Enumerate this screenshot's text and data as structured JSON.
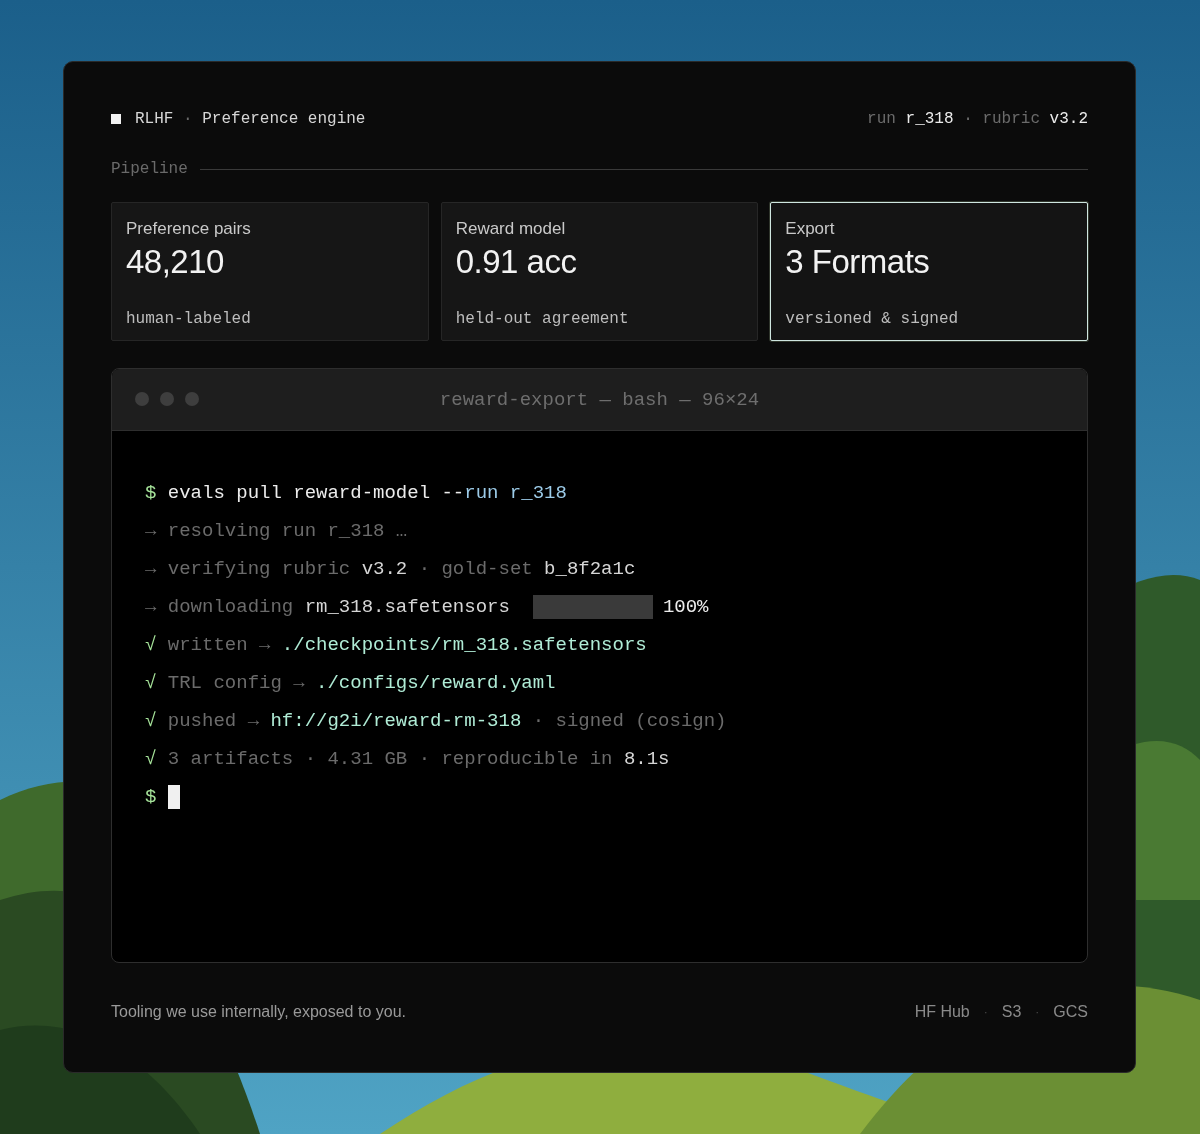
{
  "header": {
    "brand": [
      {
        "text": "RLHF",
        "kind": "value"
      },
      {
        "text": "·",
        "kind": "dim"
      },
      {
        "text": "Preference engine",
        "kind": "value"
      }
    ],
    "meta": [
      {
        "text": "run",
        "kind": "dim"
      },
      {
        "text": "r_318",
        "kind": "bright"
      },
      {
        "text": "·",
        "kind": "dim"
      },
      {
        "text": "rubric",
        "kind": "dim"
      },
      {
        "text": "v3.2",
        "kind": "bright"
      }
    ]
  },
  "section": {
    "title": "Pipeline"
  },
  "cards": [
    {
      "label": "Preference pairs",
      "value": "48,210",
      "note": "human-labeled",
      "selected": false
    },
    {
      "label": "Reward model",
      "value": "0.91 acc",
      "note": "held-out agreement",
      "selected": false
    },
    {
      "label": "Export",
      "value": "3 Formats",
      "note": "versioned & signed",
      "selected": true
    }
  ],
  "terminal": {
    "title": "reward-export — bash — 96×24",
    "lines": [
      {
        "segments": [
          {
            "kind": "prompt",
            "text": "$ "
          },
          {
            "kind": "bright",
            "text": "evals pull reward-model --"
          },
          {
            "kind": "accent",
            "text": "run r_318"
          }
        ]
      },
      {
        "segments": [
          {
            "kind": "dim",
            "text": "→ "
          },
          {
            "kind": "dim",
            "text": "resolving run r_318 …"
          }
        ]
      },
      {
        "segments": [
          {
            "kind": "dim",
            "text": "→ "
          },
          {
            "kind": "dim",
            "text": "verifying rubric "
          },
          {
            "kind": "value",
            "text": "v3.2"
          },
          {
            "kind": "dim",
            "text": " · gold-set "
          },
          {
            "kind": "value",
            "text": "b_8f2a1c"
          }
        ]
      },
      {
        "segments": [
          {
            "kind": "dim",
            "text": "→ "
          },
          {
            "kind": "dim",
            "text": "downloading "
          },
          {
            "kind": "value",
            "text": "rm_318.safetensors"
          },
          {
            "kind": "progress",
            "level": 1
          },
          {
            "kind": "bright",
            "text": "100%"
          }
        ]
      },
      {
        "segments": [
          {
            "kind": "prompt",
            "text": "√ "
          },
          {
            "kind": "dim",
            "text": "written → "
          },
          {
            "kind": "path",
            "text": "./checkpoints/rm_318.safetensors"
          }
        ]
      },
      {
        "segments": [
          {
            "kind": "prompt",
            "text": "√ "
          },
          {
            "kind": "dim",
            "text": "TRL config → "
          },
          {
            "kind": "path",
            "text": "./configs/reward.yaml"
          }
        ]
      },
      {
        "segments": [
          {
            "kind": "prompt",
            "text": "√ "
          },
          {
            "kind": "dim",
            "text": "pushed → "
          },
          {
            "kind": "path",
            "text": "hf://g2i/reward-rm-318"
          },
          {
            "kind": "dim",
            "text": " · signed (cosign)"
          }
        ]
      },
      {
        "segments": [
          {
            "kind": "prompt",
            "text": "√ "
          },
          {
            "kind": "dim",
            "text": "3 artifacts · 4.31 GB · reproducible in "
          },
          {
            "kind": "value",
            "text": "8.1s"
          }
        ]
      },
      {
        "segments": [
          {
            "kind": "prompt",
            "text": "$ "
          },
          {
            "kind": "cursor"
          }
        ]
      }
    ]
  },
  "footer": {
    "tagline": "Tooling we use internally, exposed to you.",
    "links": [
      {
        "text": "HF Hub",
        "kind": "link"
      },
      {
        "text": "·",
        "kind": "sep"
      },
      {
        "text": "S3",
        "kind": "link"
      },
      {
        "text": "·",
        "kind": "sep"
      },
      {
        "text": "GCS",
        "kind": "link"
      }
    ]
  }
}
